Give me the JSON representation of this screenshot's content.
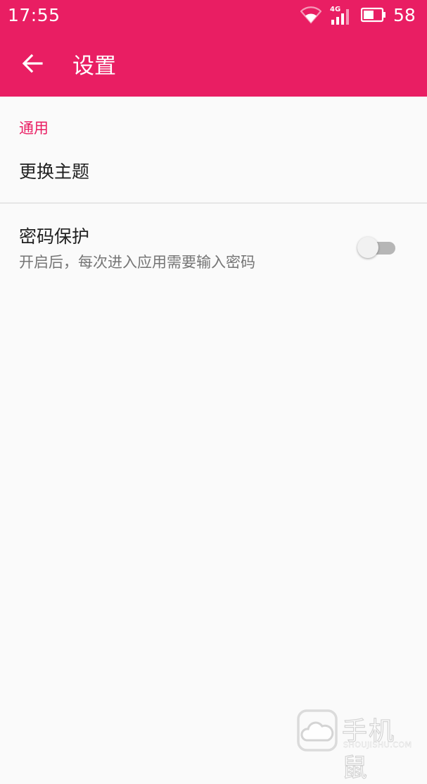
{
  "status_bar": {
    "time": "17:55",
    "network_label": "4G",
    "battery_percent": "58",
    "battery_level": 0.58
  },
  "app_bar": {
    "title": "设置",
    "color": "#e91e63"
  },
  "settings": {
    "section_general": "通用",
    "theme_item": "更换主题",
    "password_item": {
      "label": "密码保护",
      "description": "开启后，每次进入应用需要输入密码",
      "enabled": false
    }
  },
  "watermark": {
    "brand": "手机鼠",
    "site": "SHOUJISHU.COM"
  }
}
